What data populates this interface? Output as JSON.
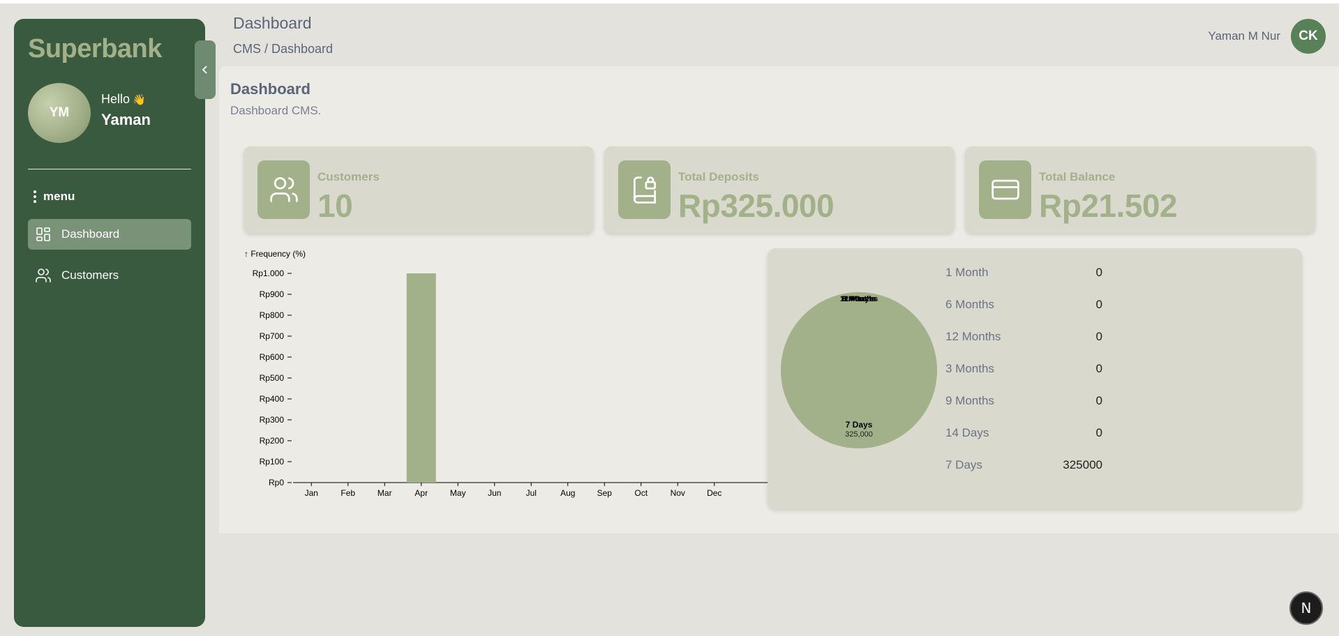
{
  "sidebar": {
    "brand": "Superbank",
    "avatar_initials": "YM",
    "greeting": "Hello",
    "greeting_emoji": "👋",
    "username": "Yaman",
    "menu_heading": "menu",
    "items": [
      {
        "label": "Dashboard",
        "icon": "dashboard-grid-icon",
        "active": true
      },
      {
        "label": "Customers",
        "icon": "users-icon",
        "active": false
      }
    ]
  },
  "header": {
    "title": "Dashboard",
    "breadcrumb": "CMS / Dashboard",
    "user_name": "Yaman M Nur",
    "user_initials": "CK"
  },
  "page": {
    "title": "Dashboard",
    "description": "Dashboard CMS."
  },
  "stats": [
    {
      "label": "Customers",
      "value": "10",
      "icon": "users-icon"
    },
    {
      "label": "Total Deposits",
      "value": "Rp325.000",
      "icon": "book-lock-icon"
    },
    {
      "label": "Total Balance",
      "value": "Rp21.502",
      "icon": "credit-card-icon"
    }
  ],
  "pie_legend": [
    {
      "label": "1 Month",
      "value": "0"
    },
    {
      "label": "6 Months",
      "value": "0"
    },
    {
      "label": "12 Months",
      "value": "0"
    },
    {
      "label": "3 Months",
      "value": "0"
    },
    {
      "label": "9 Months",
      "value": "0"
    },
    {
      "label": "14 Days",
      "value": "0"
    },
    {
      "label": "7 Days",
      "value": "325000"
    }
  ],
  "pie_labels": {
    "main_label": "7 Days",
    "main_value": "325,000",
    "overlap_labels": [
      "1 Month",
      "6 Months",
      "12 Months",
      "3 Months",
      "9 Months",
      "14 Days"
    ]
  },
  "colors": {
    "sidebar": "#3a5a40",
    "accent": "#a3b18a",
    "avatar": "#588157",
    "card": "#dad9cd"
  },
  "badge": "N",
  "chart_data": [
    {
      "type": "bar",
      "ylabel": "↑ Frequency (%)",
      "categories": [
        "Jan",
        "Feb",
        "Mar",
        "Apr",
        "May",
        "Jun",
        "Jul",
        "Aug",
        "Sep",
        "Oct",
        "Nov",
        "Dec"
      ],
      "values": [
        0,
        0,
        0,
        1000,
        0,
        0,
        0,
        0,
        0,
        0,
        0,
        0
      ],
      "ylim": [
        0,
        1000
      ],
      "yticks": [
        0,
        100,
        200,
        300,
        400,
        500,
        600,
        700,
        800,
        900,
        1000
      ],
      "ytick_labels": [
        "Rp0",
        "Rp100",
        "Rp200",
        "Rp300",
        "Rp400",
        "Rp500",
        "Rp600",
        "Rp700",
        "Rp800",
        "Rp900",
        "Rp1.000"
      ],
      "bar_color": "#a3b18a"
    },
    {
      "type": "pie",
      "categories": [
        "1 Month",
        "6 Months",
        "12 Months",
        "3 Months",
        "9 Months",
        "14 Days",
        "7 Days"
      ],
      "values": [
        0,
        0,
        0,
        0,
        0,
        0,
        325000
      ],
      "color": "#a3b18a"
    }
  ]
}
